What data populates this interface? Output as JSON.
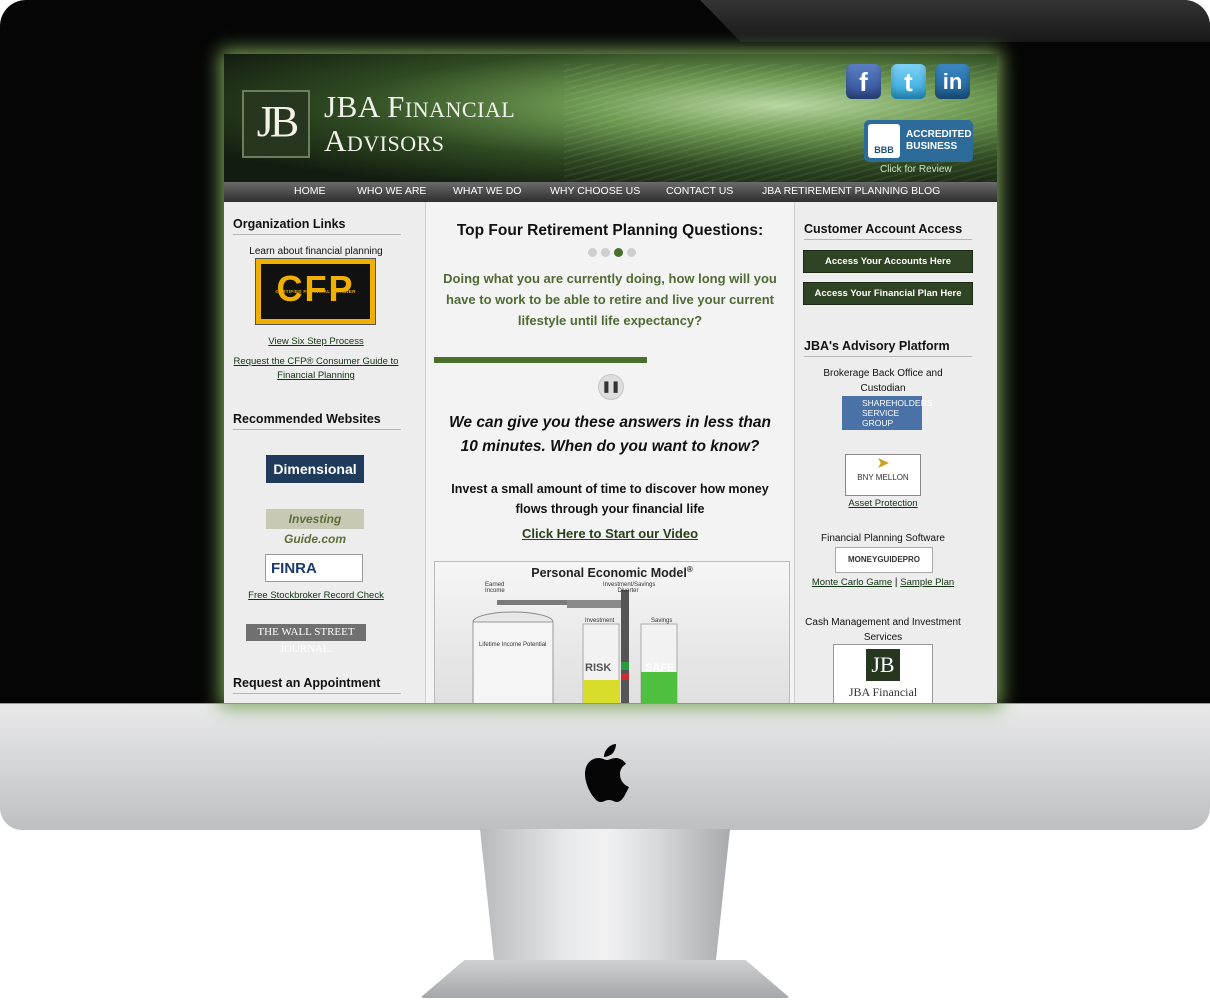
{
  "header": {
    "logo_mark": "JB",
    "logo_line1": "JBA Financial",
    "logo_line2": "Advisors",
    "social": [
      "f",
      "t",
      "in"
    ],
    "bbb_seal": "BBB",
    "bbb_line1": "ACCREDITED",
    "bbb_line2": "BUSINESS",
    "bbb_review": "Click for Review"
  },
  "nav": [
    "HOME",
    "WHO WE ARE",
    "WHAT WE DO",
    "WHY CHOOSE US",
    "CONTACT US",
    "JBA RETIREMENT PLANNING BLOG"
  ],
  "left": {
    "org_title": "Organization Links",
    "learn_text": "Learn about financial planning",
    "cfp_logo": "CFP",
    "cfp_sub": "CERTIFIED FINANCIAL PLANNER",
    "six_step_link": "View Six Step Process",
    "cfp_guide_link": "Request the CFP® Consumer Guide to Financial Planning",
    "rec_title": "Recommended Websites",
    "dimensional": "Dimensional",
    "investing": "Investing Guide.com",
    "finra": "FINRA",
    "stockbroker_link": "Free Stockbroker Record Check",
    "wsj": "THE WALL STREET JOURNAL.",
    "appt_title": "Request an Appointment"
  },
  "mid": {
    "title": "Top Four Retirement Planning Questions:",
    "question": "Doing what you are currently doing, how long will you have to work to be able to retire and live your current lifestyle until life expectancy?",
    "pause_icon": "❚❚",
    "answers": "We can give you these answers in less than 10 minutes. When do you want to know?",
    "invest": "Invest a small amount of time to discover how money flows through your financial life",
    "video_link": "Click Here to Start our Video",
    "pem_title": "Personal Economic Model",
    "pem_reg": "®",
    "pem_earned": "Earned Income",
    "pem_diverter": "Investment/Savings Diverter",
    "pem_lifetime": "Lifetime Income Potential",
    "pem_investment": "Investment",
    "pem_savings": "Savings",
    "pem_risk": "RISK",
    "pem_safe": "SAFE"
  },
  "right": {
    "customer_title": "Customer Account Access",
    "accounts_btn": "Access Your Accounts Here",
    "plan_btn": "Access Your Financial Plan Here",
    "platform_title": "JBA's Advisory Platform",
    "brokerage_text": "Brokerage Back Office and Custodian",
    "ssg": "SHAREHOLDERS SERVICE GROUP",
    "bny": "BNY MELLON",
    "asset_link": "Asset Protection",
    "fp_software": "Financial Planning Software",
    "mgp": "MONEYGUIDEPRO",
    "monte_link": "Monte Carlo Game",
    "separator": "|",
    "sample_link": "Sample Plan",
    "cash_text": "Cash Management and Investment Services",
    "jba_small": "JBA Financial"
  },
  "colors": {
    "accent_green": "#4f6b33",
    "button_green": "#2f4424",
    "nav_gray": "#3c3c3c"
  }
}
